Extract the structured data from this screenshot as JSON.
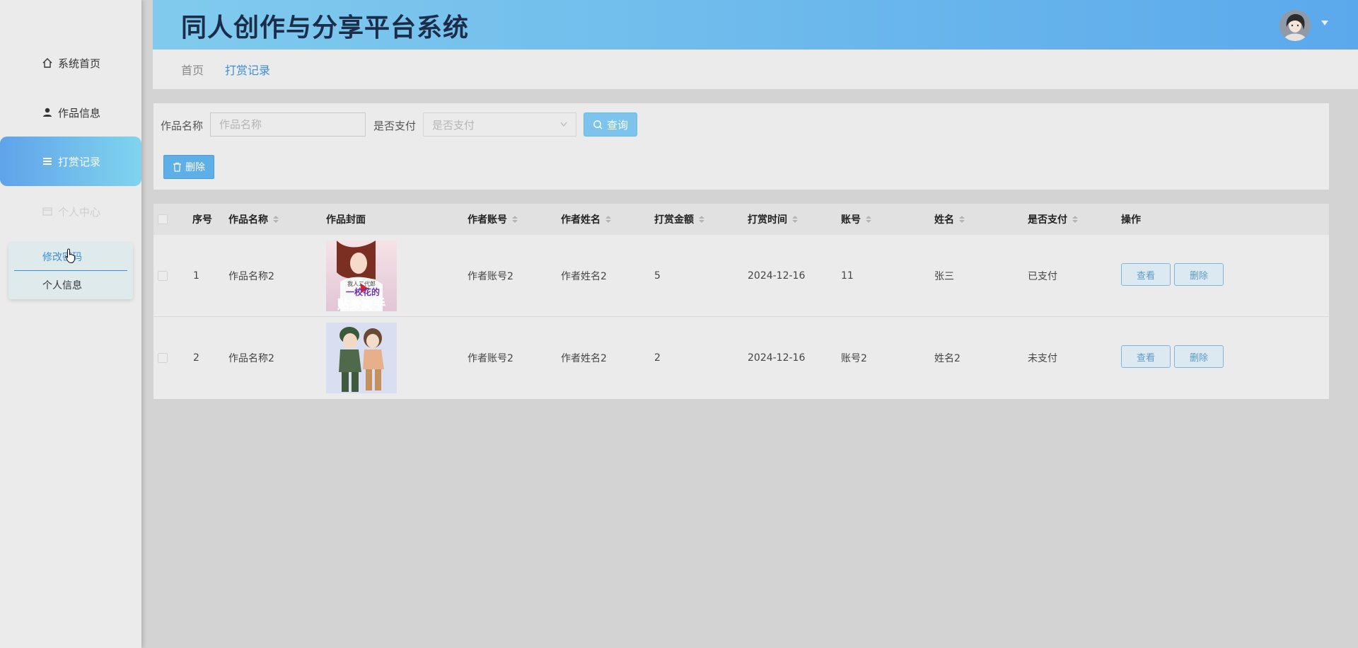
{
  "app": {
    "title": "同人创作与分享平台系统"
  },
  "sidebar": {
    "items": [
      {
        "label": "系统首页",
        "icon": "home-icon"
      },
      {
        "label": "作品信息",
        "icon": "user-icon"
      },
      {
        "label": "打赏记录",
        "icon": "menu-icon"
      },
      {
        "label": "个人中心",
        "icon": "card-icon"
      }
    ],
    "submenu": [
      {
        "label": "修改密码"
      },
      {
        "label": "个人信息"
      }
    ]
  },
  "breadcrumb": {
    "home": "首页",
    "current": "打赏记录"
  },
  "filter": {
    "name_label": "作品名称",
    "name_placeholder": "作品名称",
    "paid_label": "是否支付",
    "paid_placeholder": "是否支付",
    "query_label": "查询",
    "delete_label": "删除"
  },
  "table": {
    "headers": [
      "序号",
      "作品名称",
      "作品封面",
      "作者账号",
      "作者姓名",
      "打赏金额",
      "打赏时间",
      "账号",
      "姓名",
      "是否支付",
      "操作"
    ],
    "rows": [
      {
        "index": "1",
        "work_name": "作品名称2",
        "author_account": "作者账号2",
        "author_name": "作者姓名2",
        "amount": "5",
        "time": "2024-12-16",
        "account": "11",
        "name": "张三",
        "paid": "已支付",
        "cover_text_top": "我人二代郎",
        "cover_text_mid": "一校花的",
        "cover_text_bot": "贴身高手"
      },
      {
        "index": "2",
        "work_name": "作品名称2",
        "author_account": "作者账号2",
        "author_name": "作者姓名2",
        "amount": "2",
        "time": "2024-12-16",
        "account": "账号2",
        "name": "姓名2",
        "paid": "未支付"
      }
    ],
    "view_label": "查看",
    "delete_label": "删除"
  },
  "colors": {
    "accent": "#3d8fd6",
    "header_start": "#80cbed",
    "header_end": "#5ba9ec"
  }
}
